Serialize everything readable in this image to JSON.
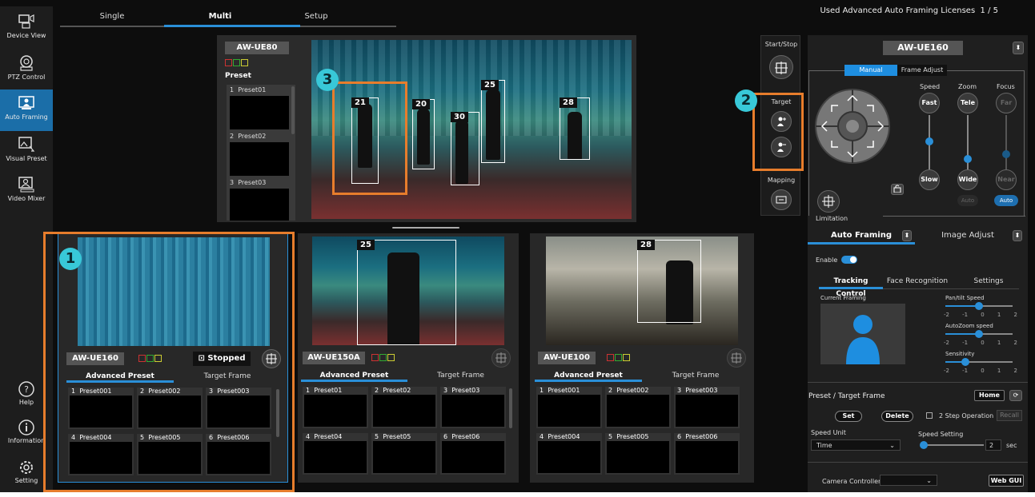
{
  "sidebar": {
    "items": [
      {
        "label": "Device View",
        "icon": "device-view-icon"
      },
      {
        "label": "PTZ Control",
        "icon": "ptz-control-icon"
      },
      {
        "label": "Auto Framing",
        "icon": "auto-framing-icon",
        "active": true
      },
      {
        "label": "Visual Preset",
        "icon": "visual-preset-icon"
      },
      {
        "label": "Video Mixer",
        "icon": "video-mixer-icon"
      }
    ],
    "bottom": [
      {
        "label": "Help",
        "icon": "help-icon"
      },
      {
        "label": "Information",
        "icon": "information-icon"
      },
      {
        "label": "Setting",
        "icon": "gear-icon"
      }
    ]
  },
  "tabs": [
    "Single",
    "Multi",
    "Setup"
  ],
  "active_tab": "Multi",
  "license_text": "Used Advanced Auto Framing Licenses",
  "license_count": "1 / 5",
  "main": {
    "camera": "AW-UE80",
    "preset_heading": "Preset",
    "presets": [
      {
        "num": "1",
        "name": "Preset01"
      },
      {
        "num": "2",
        "name": "Preset02"
      },
      {
        "num": "3",
        "name": "Preset03"
      }
    ],
    "detections": [
      "21",
      "20",
      "30",
      "25",
      "28"
    ]
  },
  "callouts": [
    "1",
    "2",
    "3"
  ],
  "side_controls": {
    "start_stop": "Start/Stop",
    "target": "Target",
    "mapping": "Mapping"
  },
  "tiles": [
    {
      "camera": "AW-UE160",
      "status": "Stopped",
      "tab1": "Advanced Preset",
      "tab2": "Target Frame",
      "presets": [
        {
          "num": "1",
          "name": "Preset001"
        },
        {
          "num": "2",
          "name": "Preset002"
        },
        {
          "num": "3",
          "name": "Preset003"
        },
        {
          "num": "4",
          "name": "Preset004"
        },
        {
          "num": "5",
          "name": "Preset005"
        },
        {
          "num": "6",
          "name": "Preset006"
        }
      ]
    },
    {
      "camera": "AW-UE150A",
      "detection": "25",
      "tab1": "Advanced Preset",
      "tab2": "Target Frame",
      "presets": [
        {
          "num": "1",
          "name": "Preset01"
        },
        {
          "num": "2",
          "name": "Preset02"
        },
        {
          "num": "3",
          "name": "Preset03"
        },
        {
          "num": "4",
          "name": "Preset04"
        },
        {
          "num": "5",
          "name": "Preset05"
        },
        {
          "num": "6",
          "name": "Preset06"
        }
      ]
    },
    {
      "camera": "AW-UE100",
      "detection": "28",
      "tab1": "Advanced Preset",
      "tab2": "Target Frame",
      "presets": [
        {
          "num": "1",
          "name": "Preset001"
        },
        {
          "num": "2",
          "name": "Preset002"
        },
        {
          "num": "3",
          "name": "Preset003"
        },
        {
          "num": "4",
          "name": "Preset004"
        },
        {
          "num": "5",
          "name": "Preset005"
        },
        {
          "num": "6",
          "name": "Preset006"
        }
      ]
    }
  ],
  "right": {
    "camera": "AW-UE160",
    "mode_tabs": [
      "Manual",
      "Frame Adjust"
    ],
    "speed": "Speed",
    "zoom": "Zoom",
    "focus": "Focus",
    "fast": "Fast",
    "slow": "Slow",
    "tele": "Tele",
    "wide": "Wide",
    "far": "Far",
    "near": "Near",
    "auto1": "Auto",
    "auto2": "Auto",
    "limitation": "Limitation",
    "section_tabs": [
      "Auto Framing",
      "Image Adjust"
    ],
    "enable": "Enable",
    "sub_tabs": [
      "Tracking Control",
      "Face Recognition",
      "Settings"
    ],
    "current_framing": "Current Framing",
    "sliders": [
      {
        "label": "Pan/tilt Speed",
        "value": 0.5
      },
      {
        "label": "AutoZoom speed",
        "value": 0.5
      },
      {
        "label": "Sensitivity",
        "value": 0.3
      }
    ],
    "scale": [
      "-2",
      "-1",
      "0",
      "1",
      "2"
    ],
    "preset_target": "Preset / Target Frame",
    "home": "Home",
    "set": "Set",
    "delete": "Delete",
    "two_step": "2 Step Operation",
    "recall": "Recall",
    "speed_unit": "Speed Unit",
    "speed_unit_value": "Time",
    "speed_setting": "Speed Setting",
    "speed_value": "2",
    "sec": "sec",
    "camera_controller": "Camera Controller",
    "web_gui": "Web GUI"
  },
  "colors": {
    "accent": "#2a8fd8",
    "highlight": "#e77d2c",
    "callout": "#38c8d8"
  }
}
